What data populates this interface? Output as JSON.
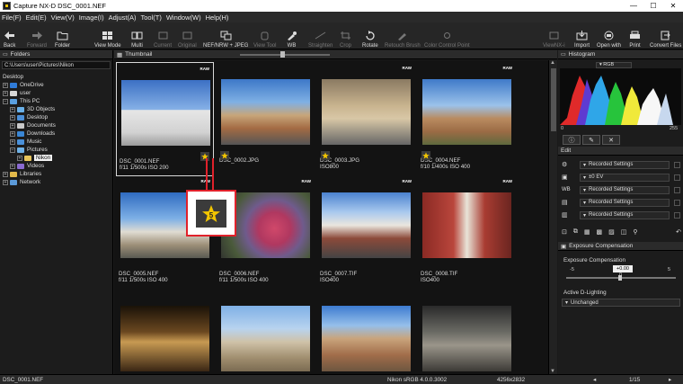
{
  "titlebar": {
    "title": "Capture NX-D     DSC_0001.NEF",
    "minimize": "—",
    "maximize": "☐",
    "close": "✕"
  },
  "menu": [
    "File(F)",
    "Edit(E)",
    "View(V)",
    "Image(I)",
    "Adjust(A)",
    "Tool(T)",
    "Window(W)",
    "Help(H)"
  ],
  "toolbar": {
    "back": "Back",
    "forward": "Forward",
    "folder": "Folder",
    "view_mode": "View Mode",
    "multi": "Multi",
    "current": "Current",
    "original": "Original",
    "nef_jpeg": "NEF/NRW + JPEG",
    "view_tool": "View Tool",
    "wb": "WB",
    "straighten": "Straighten",
    "crop": "Crop",
    "rotate": "Rotate",
    "retouch_brush": "Retouch Brush",
    "color_control_point": "Color Control Point",
    "viewnx": "ViewNX-i",
    "import": "Import",
    "open_with": "Open with",
    "print": "Print",
    "convert_files": "Convert Files"
  },
  "folders": {
    "title": "Folders",
    "path": "C:\\Users\\user\\Pictures\\Nikon",
    "tree": [
      {
        "label": "Desktop",
        "expander": "−"
      },
      {
        "label": "OneDrive",
        "expander": "+"
      },
      {
        "label": "user",
        "expander": "+"
      },
      {
        "label": "This PC",
        "expander": "−"
      },
      {
        "label": "3D Objects",
        "expander": "+"
      },
      {
        "label": "Desktop",
        "expander": "+"
      },
      {
        "label": "Documents",
        "expander": "+"
      },
      {
        "label": "Downloads",
        "expander": "+"
      },
      {
        "label": "Music",
        "expander": "+"
      },
      {
        "label": "Pictures",
        "expander": "−"
      },
      {
        "label": "Nikon",
        "expander": "+"
      },
      {
        "label": "Videos",
        "expander": "+"
      },
      {
        "label": "Libraries",
        "expander": "+"
      },
      {
        "label": "Network",
        "expander": "+"
      }
    ]
  },
  "thumbnail": {
    "title": "Thumbnail",
    "items": [
      {
        "name": "DSC_0001.NEF",
        "info": "f/11 1/500s ISO 200",
        "raw": "RAW",
        "starred": true
      },
      {
        "name": "DSC_0002.JPG",
        "info": "",
        "raw": "",
        "starred": true
      },
      {
        "name": "DSC_0003.JPG",
        "info": "ISO800",
        "raw": "RAW",
        "starred": true
      },
      {
        "name": "DSC_0004.NEF",
        "info": "f/10 1/400s ISO 400",
        "raw": "RAW",
        "starred": true
      },
      {
        "name": "DSC_0005.NEF",
        "info": "f/11 1/500s ISO 400",
        "raw": "RAW",
        "starred": false
      },
      {
        "name": "DSC_0006.NEF",
        "info": "f/11 1/500s ISO 400",
        "raw": "RAW",
        "starred": false
      },
      {
        "name": "DSC_0007.TIF",
        "info": "ISO400",
        "raw": "RAW",
        "starred": false
      },
      {
        "name": "DSC_0008.TIF",
        "info": "ISO400",
        "raw": "RAW",
        "starred": false
      },
      {
        "name": "",
        "info": "",
        "raw": "",
        "starred": false
      },
      {
        "name": "",
        "info": "",
        "raw": "",
        "starred": false
      },
      {
        "name": "",
        "info": "",
        "raw": "",
        "starred": false
      },
      {
        "name": "",
        "info": "",
        "raw": "",
        "starred": false
      }
    ]
  },
  "callout": {
    "label": "Label 5 badge",
    "number": "5"
  },
  "histogram": {
    "title": "Histogram",
    "channel": "RGB",
    "min": "0",
    "max": "255"
  },
  "edit": {
    "title": "Edit",
    "rows": [
      "Recorded Settings",
      "±0 EV",
      "Recorded Settings",
      "Recorded Settings",
      "Recorded Settings"
    ]
  },
  "exposure": {
    "title": "Exposure Compensation",
    "label": "Exposure Compensation",
    "ticks": [
      "-5",
      "0",
      "5"
    ],
    "value": "+0.00",
    "active_dlighting": "Active D-Lighting",
    "dlighting_value": "Unchanged"
  },
  "status": {
    "file": "DSC_0001.NEF",
    "profile": "Nikon sRGB 4.0.0.3002",
    "dimensions": "4256x2832",
    "page": "1/15"
  },
  "colors": {
    "accent": "#f2c500",
    "callout": "#e0212b",
    "folder": "#e7c45a"
  }
}
